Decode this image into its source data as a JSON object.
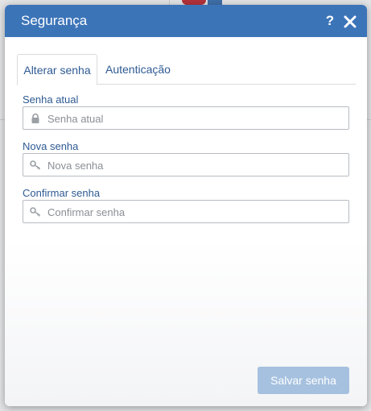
{
  "dialog": {
    "title": "Segurança",
    "header_color": "#3c74b8",
    "help_icon": "question-icon",
    "close_icon": "close-icon"
  },
  "tabs": [
    {
      "label": "Alterar senha",
      "active": true
    },
    {
      "label": "Autenticação",
      "active": false
    }
  ],
  "form": {
    "current_password": {
      "label": "Senha atual",
      "placeholder": "Senha atual",
      "icon": "lock-icon",
      "value": ""
    },
    "new_password": {
      "label": "Nova senha",
      "placeholder": "Nova senha",
      "icon": "key-icon",
      "value": ""
    },
    "confirm_password": {
      "label": "Confirmar senha",
      "placeholder": "Confirmar senha",
      "icon": "key-icon",
      "value": ""
    }
  },
  "actions": {
    "save_label": "Salvar senha",
    "save_color": "#a6c1df",
    "save_disabled": true
  }
}
